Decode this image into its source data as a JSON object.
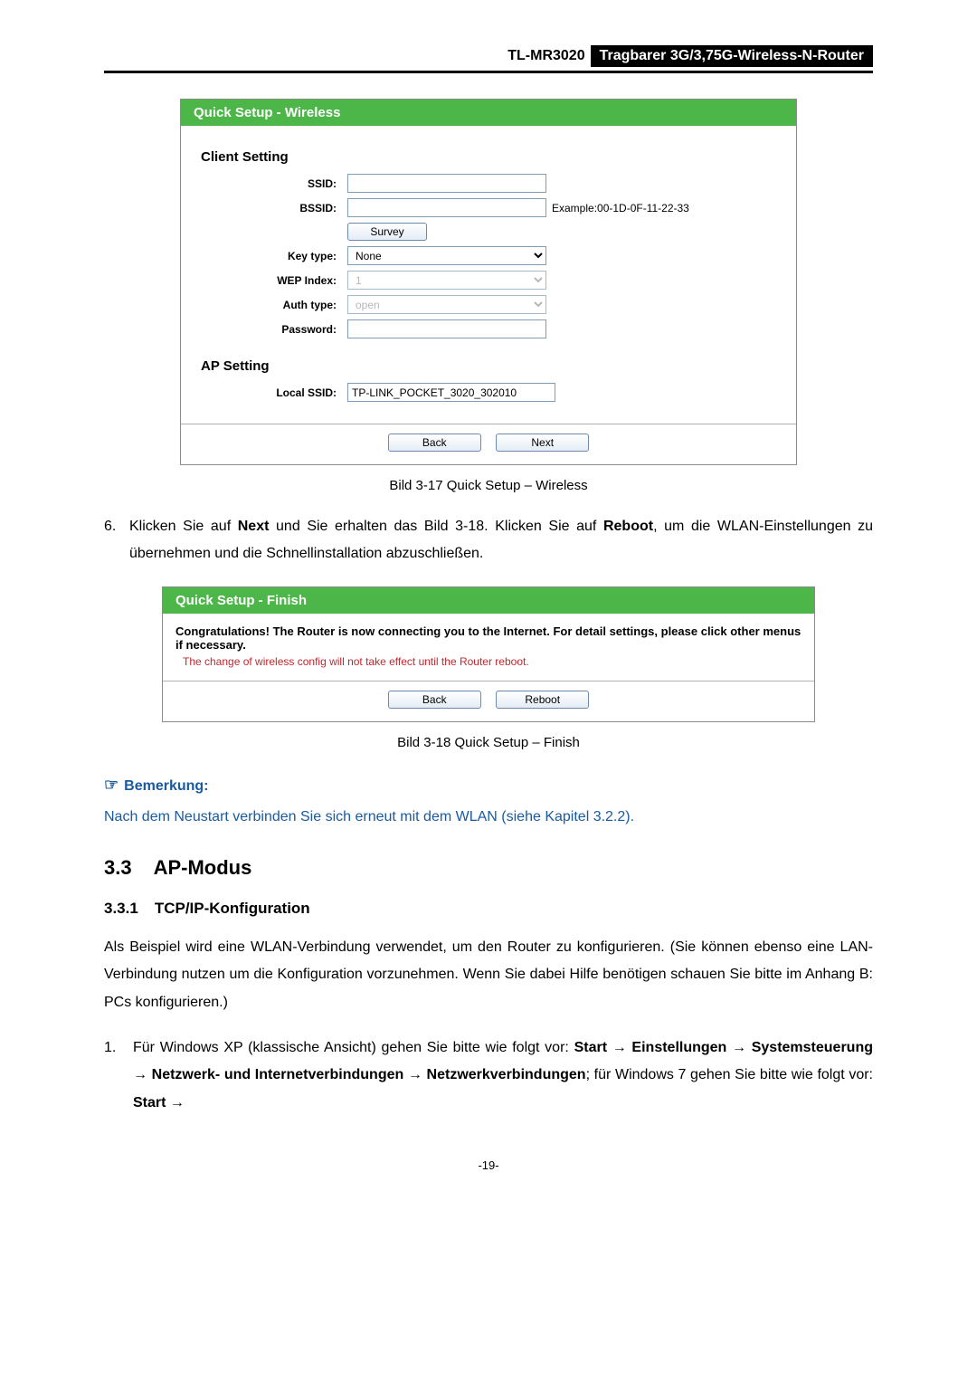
{
  "header": {
    "model": "TL-MR3020",
    "desc": "Tragbarer 3G/3,75G-Wireless-N-Router"
  },
  "fig1": {
    "title": "Quick Setup - Wireless",
    "client_title": "Client Setting",
    "ssid_label": "SSID:",
    "ssid_value": "",
    "bssid_label": "BSSID:",
    "bssid_value": "",
    "bssid_hint": "Example:00-1D-0F-11-22-33",
    "survey_btn": "Survey",
    "keytype_label": "Key type:",
    "keytype_value": "None",
    "wepindex_label": "WEP Index:",
    "wepindex_value": "1",
    "authtype_label": "Auth type:",
    "authtype_value": "open",
    "password_label": "Password:",
    "password_value": "",
    "ap_title": "AP Setting",
    "localssid_label": "Local SSID:",
    "localssid_value": "TP-LINK_POCKET_3020_302010",
    "back_btn": "Back",
    "next_btn": "Next",
    "caption": "Bild 3-17 Quick Setup – Wireless"
  },
  "step6": {
    "num": "6.",
    "text_a": "Klicken Sie auf ",
    "bold_a": "Next",
    "text_b": " und Sie erhalten das Bild 3-18. Klicken Sie auf ",
    "bold_b": "Reboot",
    "text_c": ", um die WLAN-Einstellungen zu übernehmen und die Schnellinstallation abzuschließen."
  },
  "fig2": {
    "title": "Quick Setup - Finish",
    "msg": "Congratulations! The Router is now connecting you to the Internet. For detail settings, please click other menus if necessary.",
    "warn": "The change of wireless config will not take effect until the Router reboot.",
    "back_btn": "Back",
    "reboot_btn": "Reboot",
    "caption": "Bild 3-18 Quick Setup – Finish"
  },
  "note": {
    "head": "Bemerkung:",
    "body": "Nach dem Neustart verbinden Sie sich erneut mit dem WLAN (siehe Kapitel 3.2.2)."
  },
  "sec": {
    "idx": "3.3",
    "title": "AP-Modus"
  },
  "sub": {
    "idx": "3.3.1",
    "title": "TCP/IP-Konfiguration"
  },
  "para": "Als Beispiel wird eine WLAN-Verbindung verwendet, um den Router zu konfigurieren. (Sie können ebenso eine LAN-Verbindung nutzen um die Konfiguration vorzunehmen. Wenn Sie dabei Hilfe benötigen schauen Sie bitte im Anhang B: PCs konfigurieren.)",
  "list1": {
    "no": "1.",
    "t1": "Für Windows XP (klassische Ansicht) gehen Sie bitte wie folgt vor: ",
    "b1": "Start → Einstellungen → Systemsteuerung → Netzwerk- und Internetverbindungen → Netzwerkverbindungen",
    "t2": "; für Windows 7 gehen Sie bitte wie folgt vor: ",
    "b2": "Start →"
  },
  "footer": "-19-"
}
